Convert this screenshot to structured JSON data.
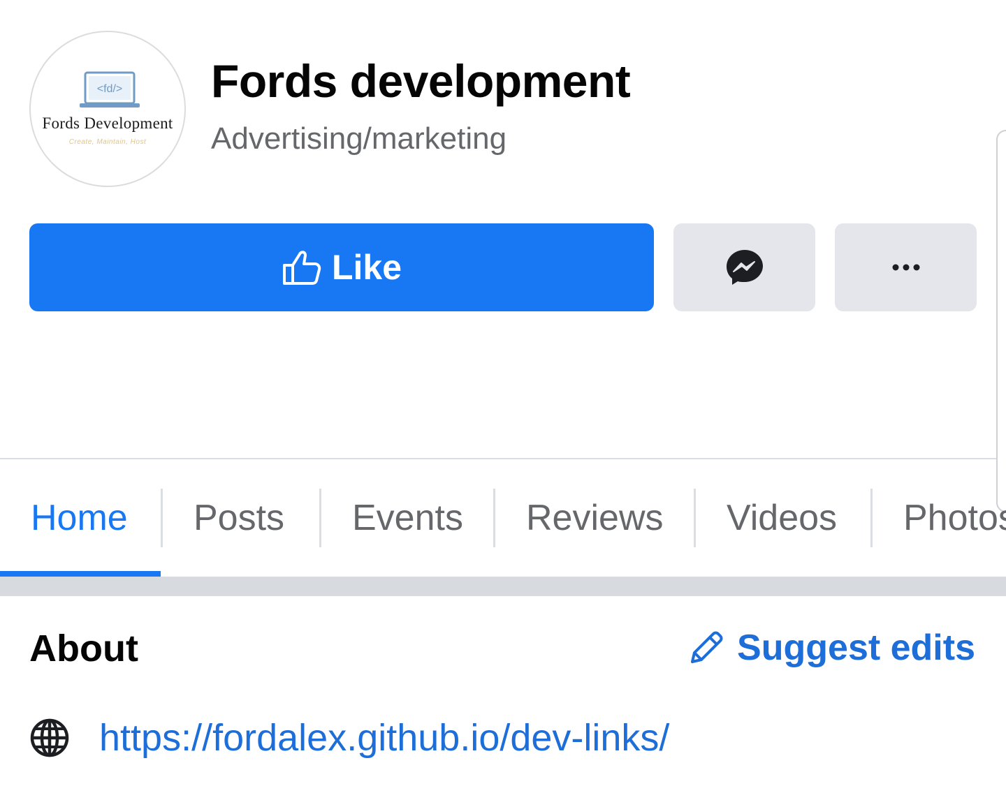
{
  "header": {
    "title": "Fords development",
    "category": "Advertising/marketing",
    "avatar": {
      "logo_code": "<fd/>",
      "brand": "Fords Development",
      "tagline": "Create, Maintain, Host"
    }
  },
  "actions": {
    "like_label": "Like",
    "messenger_icon": "messenger-icon",
    "more_icon": "more-icon"
  },
  "tabs": [
    {
      "label": "Home",
      "active": true
    },
    {
      "label": "Posts",
      "active": false
    },
    {
      "label": "Events",
      "active": false
    },
    {
      "label": "Reviews",
      "active": false
    },
    {
      "label": "Videos",
      "active": false
    },
    {
      "label": "Photos",
      "active": false
    }
  ],
  "about": {
    "title": "About",
    "suggest_edits_label": "Suggest edits",
    "website": "https://fordalex.github.io/dev-links/"
  },
  "colors": {
    "primary": "#1877f2",
    "link": "#1d6ed8",
    "secondary_button": "#e4e6eb",
    "muted_text": "#65676b"
  }
}
